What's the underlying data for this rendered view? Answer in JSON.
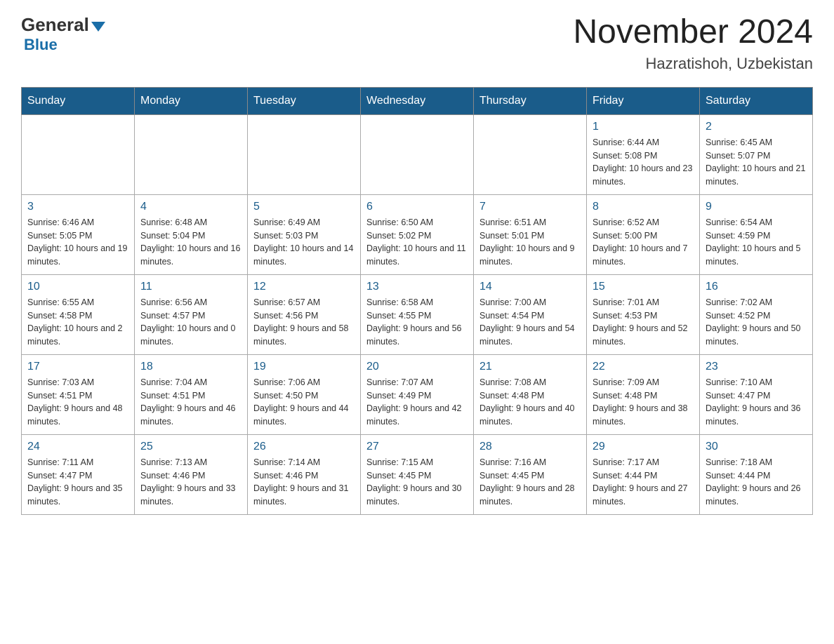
{
  "logo": {
    "general": "General",
    "blue": "Blue"
  },
  "title": {
    "month_year": "November 2024",
    "location": "Hazratishoh, Uzbekistan"
  },
  "days_of_week": [
    "Sunday",
    "Monday",
    "Tuesday",
    "Wednesday",
    "Thursday",
    "Friday",
    "Saturday"
  ],
  "weeks": [
    [
      {
        "day": "",
        "info": ""
      },
      {
        "day": "",
        "info": ""
      },
      {
        "day": "",
        "info": ""
      },
      {
        "day": "",
        "info": ""
      },
      {
        "day": "",
        "info": ""
      },
      {
        "day": "1",
        "info": "Sunrise: 6:44 AM\nSunset: 5:08 PM\nDaylight: 10 hours and 23 minutes."
      },
      {
        "day": "2",
        "info": "Sunrise: 6:45 AM\nSunset: 5:07 PM\nDaylight: 10 hours and 21 minutes."
      }
    ],
    [
      {
        "day": "3",
        "info": "Sunrise: 6:46 AM\nSunset: 5:05 PM\nDaylight: 10 hours and 19 minutes."
      },
      {
        "day": "4",
        "info": "Sunrise: 6:48 AM\nSunset: 5:04 PM\nDaylight: 10 hours and 16 minutes."
      },
      {
        "day": "5",
        "info": "Sunrise: 6:49 AM\nSunset: 5:03 PM\nDaylight: 10 hours and 14 minutes."
      },
      {
        "day": "6",
        "info": "Sunrise: 6:50 AM\nSunset: 5:02 PM\nDaylight: 10 hours and 11 minutes."
      },
      {
        "day": "7",
        "info": "Sunrise: 6:51 AM\nSunset: 5:01 PM\nDaylight: 10 hours and 9 minutes."
      },
      {
        "day": "8",
        "info": "Sunrise: 6:52 AM\nSunset: 5:00 PM\nDaylight: 10 hours and 7 minutes."
      },
      {
        "day": "9",
        "info": "Sunrise: 6:54 AM\nSunset: 4:59 PM\nDaylight: 10 hours and 5 minutes."
      }
    ],
    [
      {
        "day": "10",
        "info": "Sunrise: 6:55 AM\nSunset: 4:58 PM\nDaylight: 10 hours and 2 minutes."
      },
      {
        "day": "11",
        "info": "Sunrise: 6:56 AM\nSunset: 4:57 PM\nDaylight: 10 hours and 0 minutes."
      },
      {
        "day": "12",
        "info": "Sunrise: 6:57 AM\nSunset: 4:56 PM\nDaylight: 9 hours and 58 minutes."
      },
      {
        "day": "13",
        "info": "Sunrise: 6:58 AM\nSunset: 4:55 PM\nDaylight: 9 hours and 56 minutes."
      },
      {
        "day": "14",
        "info": "Sunrise: 7:00 AM\nSunset: 4:54 PM\nDaylight: 9 hours and 54 minutes."
      },
      {
        "day": "15",
        "info": "Sunrise: 7:01 AM\nSunset: 4:53 PM\nDaylight: 9 hours and 52 minutes."
      },
      {
        "day": "16",
        "info": "Sunrise: 7:02 AM\nSunset: 4:52 PM\nDaylight: 9 hours and 50 minutes."
      }
    ],
    [
      {
        "day": "17",
        "info": "Sunrise: 7:03 AM\nSunset: 4:51 PM\nDaylight: 9 hours and 48 minutes."
      },
      {
        "day": "18",
        "info": "Sunrise: 7:04 AM\nSunset: 4:51 PM\nDaylight: 9 hours and 46 minutes."
      },
      {
        "day": "19",
        "info": "Sunrise: 7:06 AM\nSunset: 4:50 PM\nDaylight: 9 hours and 44 minutes."
      },
      {
        "day": "20",
        "info": "Sunrise: 7:07 AM\nSunset: 4:49 PM\nDaylight: 9 hours and 42 minutes."
      },
      {
        "day": "21",
        "info": "Sunrise: 7:08 AM\nSunset: 4:48 PM\nDaylight: 9 hours and 40 minutes."
      },
      {
        "day": "22",
        "info": "Sunrise: 7:09 AM\nSunset: 4:48 PM\nDaylight: 9 hours and 38 minutes."
      },
      {
        "day": "23",
        "info": "Sunrise: 7:10 AM\nSunset: 4:47 PM\nDaylight: 9 hours and 36 minutes."
      }
    ],
    [
      {
        "day": "24",
        "info": "Sunrise: 7:11 AM\nSunset: 4:47 PM\nDaylight: 9 hours and 35 minutes."
      },
      {
        "day": "25",
        "info": "Sunrise: 7:13 AM\nSunset: 4:46 PM\nDaylight: 9 hours and 33 minutes."
      },
      {
        "day": "26",
        "info": "Sunrise: 7:14 AM\nSunset: 4:46 PM\nDaylight: 9 hours and 31 minutes."
      },
      {
        "day": "27",
        "info": "Sunrise: 7:15 AM\nSunset: 4:45 PM\nDaylight: 9 hours and 30 minutes."
      },
      {
        "day": "28",
        "info": "Sunrise: 7:16 AM\nSunset: 4:45 PM\nDaylight: 9 hours and 28 minutes."
      },
      {
        "day": "29",
        "info": "Sunrise: 7:17 AM\nSunset: 4:44 PM\nDaylight: 9 hours and 27 minutes."
      },
      {
        "day": "30",
        "info": "Sunrise: 7:18 AM\nSunset: 4:44 PM\nDaylight: 9 hours and 26 minutes."
      }
    ]
  ]
}
